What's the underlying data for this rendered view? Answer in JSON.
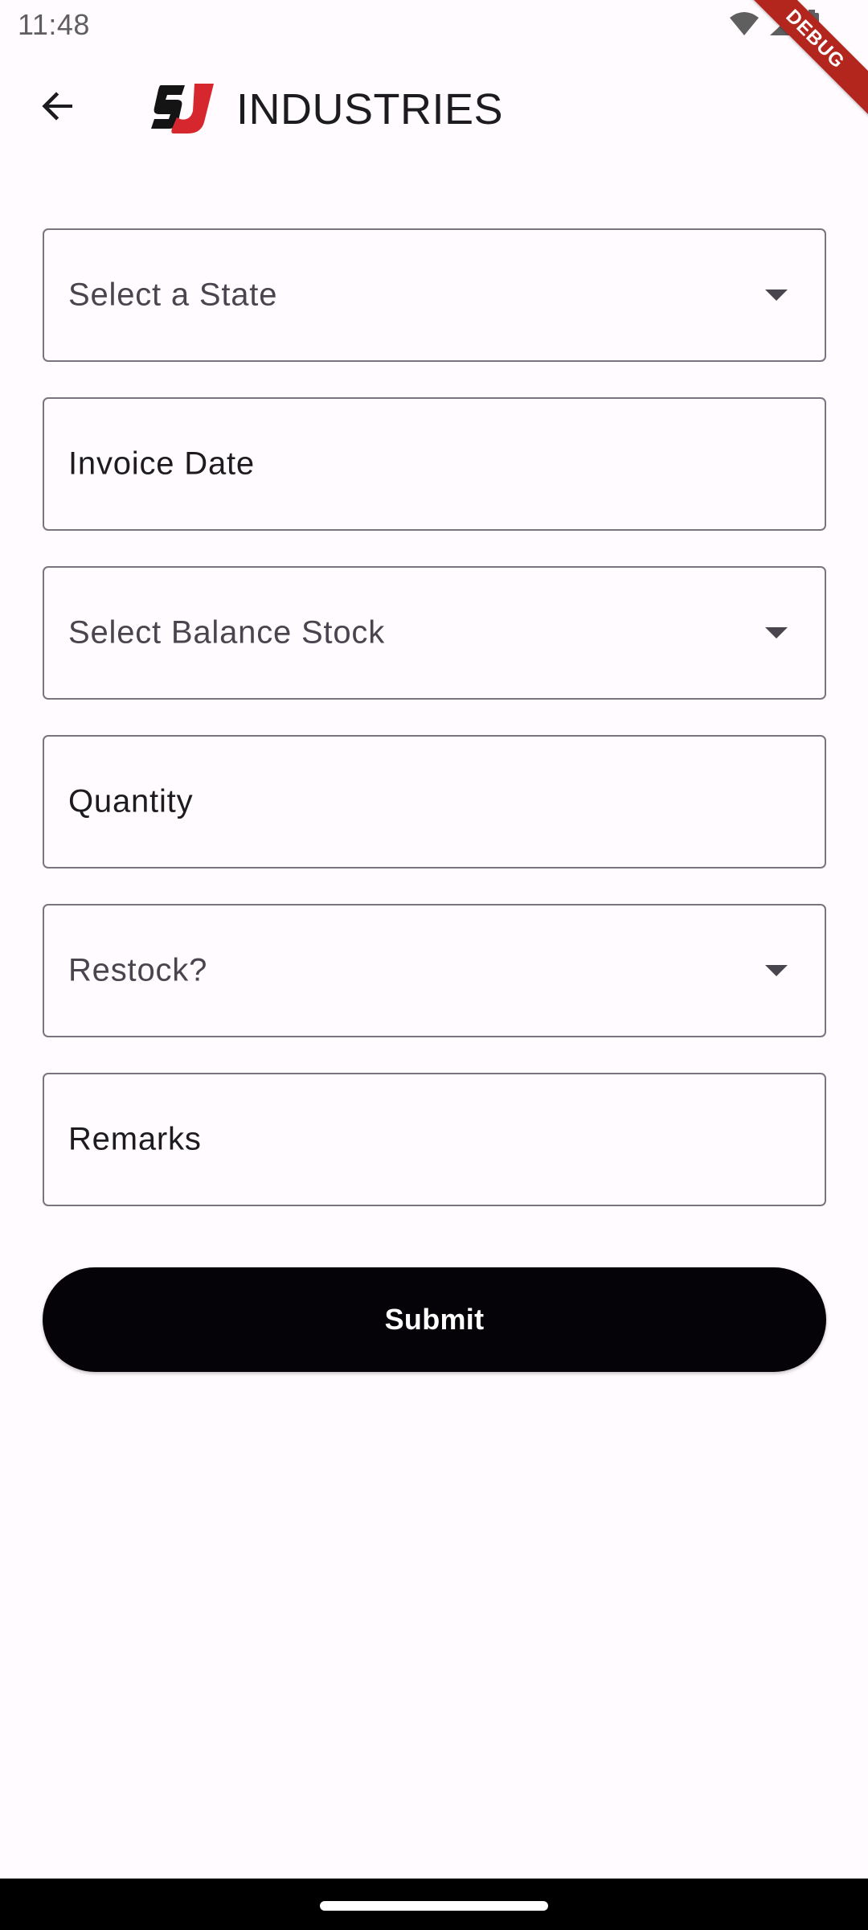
{
  "status_bar": {
    "time": "11:48",
    "icons": [
      "wifi-icon",
      "cellular-signal-icon",
      "battery-icon"
    ]
  },
  "debug_banner": {
    "label": "DEBUG"
  },
  "app_bar": {
    "back_icon": "arrow-back-icon",
    "logo_icon": "sj-logo",
    "title": "INDUSTRIES"
  },
  "form": {
    "state_dropdown": {
      "placeholder": "Select a State",
      "icon": "dropdown-arrow-icon"
    },
    "invoice_date": {
      "label": "Invoice Date"
    },
    "balance_stock_dropdown": {
      "placeholder": "Select Balance Stock",
      "icon": "dropdown-arrow-icon"
    },
    "quantity": {
      "label": "Quantity"
    },
    "restock_dropdown": {
      "placeholder": "Restock?",
      "icon": "dropdown-arrow-icon"
    },
    "remarks": {
      "label": "Remarks"
    },
    "submit_label": "Submit"
  },
  "colors": {
    "background": "#FFFBFE",
    "outline": "#79747E",
    "button": "#050308",
    "debug_ribbon": "#B3261E",
    "logo_red": "#D7272E",
    "logo_black": "#141414"
  }
}
